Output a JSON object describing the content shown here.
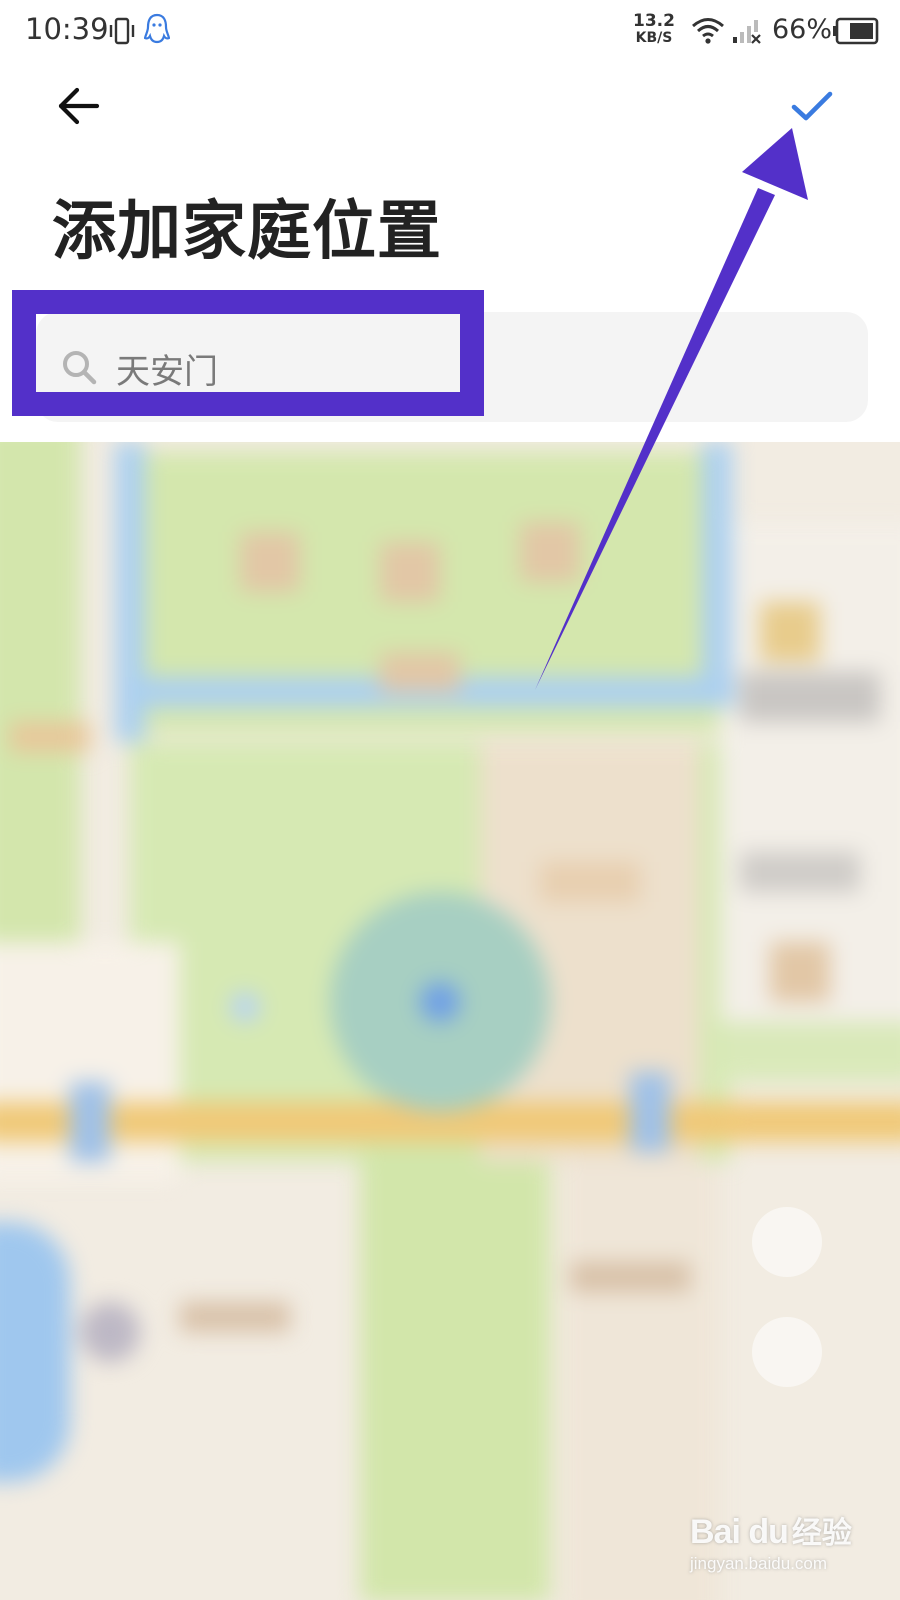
{
  "status_bar": {
    "time": "10:39",
    "net_speed_value": "13.2",
    "net_speed_unit": "KB/S",
    "battery_percent": "66%",
    "icons": [
      "vibrate-icon",
      "qq-icon",
      "wifi-icon",
      "signal-icon",
      "battery-icon"
    ]
  },
  "header": {
    "back_icon": "arrow-left-icon",
    "confirm_icon": "check-icon",
    "title": "添加家庭位置"
  },
  "search": {
    "icon": "search-icon",
    "value": "天安门"
  },
  "map": {
    "zoom_controls": [
      "zoom-in-icon",
      "zoom-out-icon"
    ]
  },
  "watermark": {
    "brand": "Bai du",
    "brand_cn": "经验",
    "url": "jingyan.baidu.com"
  },
  "colors": {
    "accent_check": "#3a7be0",
    "annotation": "#5330c9",
    "title_text": "#222222",
    "search_bg": "#f4f4f4",
    "map_park": "#cfe3a6",
    "map_water": "#a9cdee",
    "map_road": "#f0c978"
  }
}
